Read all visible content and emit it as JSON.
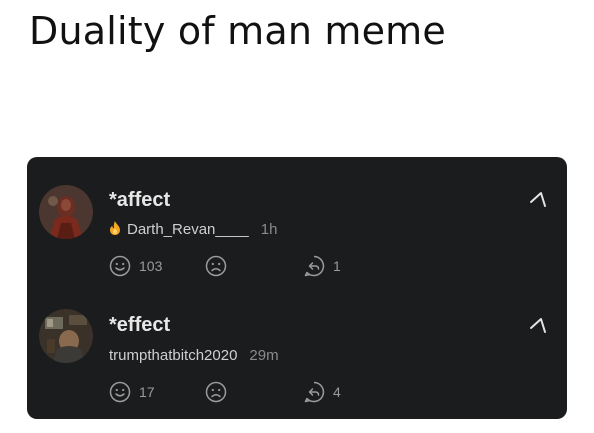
{
  "page": {
    "title": "Duality of man meme"
  },
  "comments": [
    {
      "text": "*affect",
      "author": "Darth_Revan____",
      "flair_icon": "fire-icon",
      "age": "1h",
      "likes": "103",
      "replies": "1"
    },
    {
      "text": "*effect",
      "author": "trumpthatbitch2020",
      "age": "29m",
      "likes": "17",
      "replies": "4"
    }
  ],
  "colors": {
    "panel_bg": "#1b1c1e",
    "text": "#e7e7e7",
    "muted": "#8a8b8d",
    "flair": "#f5a623"
  }
}
